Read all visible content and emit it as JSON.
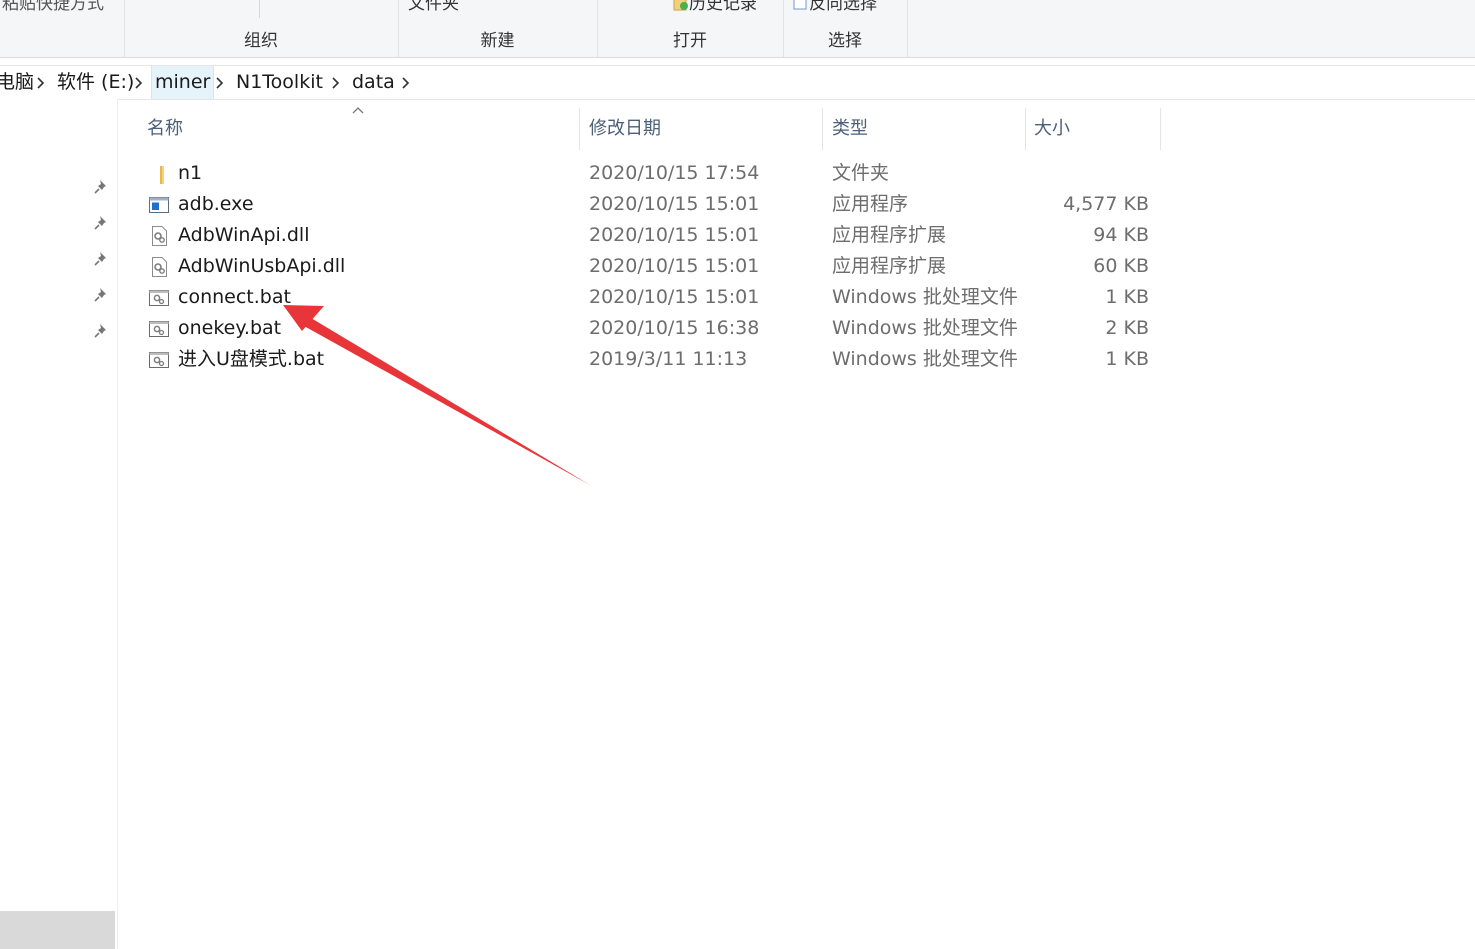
{
  "ribbon": {
    "cut_left_text": "粘贴快捷方式",
    "groups": [
      {
        "label": "组织"
      },
      {
        "label": "新建",
        "cut_text": "文件夹"
      },
      {
        "label": "打开",
        "cut_text": "历史记录"
      },
      {
        "label": "选择",
        "cut_text": "反向选择"
      }
    ]
  },
  "breadcrumb": {
    "items": [
      "电脑",
      "软件 (E:)",
      "miner",
      "N1Toolkit",
      "data"
    ]
  },
  "columns": {
    "name": "名称",
    "date": "修改日期",
    "type": "类型",
    "size": "大小"
  },
  "files": [
    {
      "name": "n1",
      "date": "2020/10/15 17:54",
      "type": "文件夹",
      "size": "",
      "icon": "folder-icon"
    },
    {
      "name": "adb.exe",
      "date": "2020/10/15 15:01",
      "type": "应用程序",
      "size": "4,577 KB",
      "icon": "exe-icon"
    },
    {
      "name": "AdbWinApi.dll",
      "date": "2020/10/15 15:01",
      "type": "应用程序扩展",
      "size": "94 KB",
      "icon": "dll-icon"
    },
    {
      "name": "AdbWinUsbApi.dll",
      "date": "2020/10/15 15:01",
      "type": "应用程序扩展",
      "size": "60 KB",
      "icon": "dll-icon"
    },
    {
      "name": "connect.bat",
      "date": "2020/10/15 15:01",
      "type": "Windows 批处理文件",
      "size": "1 KB",
      "icon": "bat-icon"
    },
    {
      "name": "onekey.bat",
      "date": "2020/10/15 16:38",
      "type": "Windows 批处理文件",
      "size": "2 KB",
      "icon": "bat-icon"
    },
    {
      "name": "进入U盘模式.bat",
      "date": "2019/3/11 11:13",
      "type": "Windows 批处理文件",
      "size": "1 KB",
      "icon": "bat-icon"
    }
  ],
  "annotation": {
    "icon": "red-arrow-icon",
    "color": "#e8353a"
  },
  "colors": {
    "header_text": "#4c607a",
    "detail_text": "#6d6d6d",
    "selection": "#e5f3fb"
  }
}
